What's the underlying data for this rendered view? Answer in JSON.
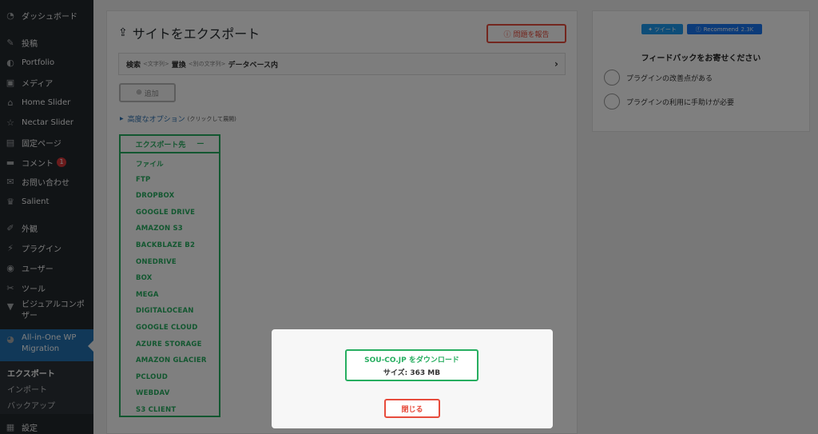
{
  "sidebar": {
    "items": [
      {
        "label": "ダッシュボード",
        "icon": "dashboard-icon",
        "glyph": "◔"
      },
      {
        "label": "投稿",
        "icon": "pin-icon",
        "glyph": "✎"
      },
      {
        "label": "Portfolio",
        "icon": "portfolio-icon",
        "glyph": "◐"
      },
      {
        "label": "メディア",
        "icon": "media-icon",
        "glyph": "▣"
      },
      {
        "label": "Home Slider",
        "icon": "home-icon",
        "glyph": "⌂"
      },
      {
        "label": "Nectar Slider",
        "icon": "star-icon",
        "glyph": "☆"
      },
      {
        "label": "固定ページ",
        "icon": "page-icon",
        "glyph": "▤"
      },
      {
        "label": "コメント",
        "icon": "comment-icon",
        "glyph": "▬",
        "badge": "1"
      },
      {
        "label": "お問い合わせ",
        "icon": "mail-icon",
        "glyph": "✉"
      },
      {
        "label": "Salient",
        "icon": "crown-icon",
        "glyph": "♛"
      },
      {
        "label": "外観",
        "icon": "brush-icon",
        "glyph": "✐"
      },
      {
        "label": "プラグイン",
        "icon": "plugin-icon",
        "glyph": "⚡"
      },
      {
        "label": "ユーザー",
        "icon": "user-icon",
        "glyph": "◉"
      },
      {
        "label": "ツール",
        "icon": "wrench-icon",
        "glyph": "✂"
      },
      {
        "label": "ビジュアルコンポ\nザー",
        "icon": "visual-composer-icon",
        "glyph": "▼"
      },
      {
        "label": "All-in-One WP\nMigration",
        "icon": "migration-icon",
        "glyph": "◕"
      }
    ],
    "subitems": [
      "エクスポート",
      "インポート",
      "バックアップ"
    ],
    "settings_label": "設定"
  },
  "main": {
    "title": "サイトをエクスポート",
    "report_button": "問題を報告",
    "search": {
      "find_label": "検索",
      "find_placeholder": "<文字列>",
      "replace_label": "置換",
      "replace_placeholder": "<別の文字列>",
      "scope_label": "データベース内"
    },
    "add_button": "追加",
    "advanced_options": "高度なオプション",
    "advanced_hint": "(クリックして展開)",
    "export_to": "エクスポート先",
    "export_targets": [
      "ファイル",
      "FTP",
      "DROPBOX",
      "GOOGLE DRIVE",
      "AMAZON S3",
      "BACKBLAZE B2",
      "ONEDRIVE",
      "BOX",
      "MEGA",
      "DIGITALOCEAN",
      "GOOGLE CLOUD",
      "AZURE STORAGE",
      "AMAZON GLACIER",
      "PCLOUD",
      "WEBDAV",
      "S3 CLIENT"
    ]
  },
  "feedback": {
    "tweet": "ツイート",
    "recommend": "Recommend",
    "recommend_count": "2.3K",
    "title": "フィードバックをお寄せください",
    "options": [
      "プラグインの改善点がある",
      "プラグインの利用に手助けが必要"
    ]
  },
  "modal": {
    "download_title": "SOU-CO.JP をダウンロード",
    "size_text": "サイズ: 363 MB",
    "close_button": "閉じる"
  },
  "colors": {
    "sidebar_bg": "#23282d",
    "active_bg": "#2271b1",
    "green": "#27ae60",
    "red": "#e74c3c"
  }
}
